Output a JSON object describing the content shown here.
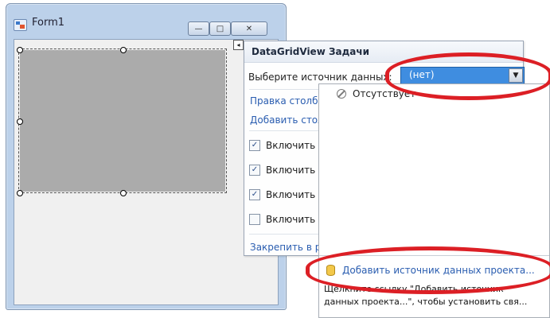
{
  "form": {
    "title": "Form1",
    "min_glyph": "—",
    "max_glyph": "□",
    "close_glyph": "✕"
  },
  "tasks_panel": {
    "title": "DataGridView Задачи",
    "smart_tag_glyph": "◂",
    "datasource_label": "Выберите источник данных:",
    "datasource_value": "(нет)",
    "dropdown_glyph": "▼",
    "links": [
      "Правка столбцов...",
      "Добавить столбец..."
    ],
    "options": [
      {
        "label": "Включить добавление",
        "checked": true
      },
      {
        "label": "Включить правку",
        "checked": true
      },
      {
        "label": "Включить удаление",
        "checked": true
      },
      {
        "label": "Включить переупорядочение столбцов",
        "checked": false
      }
    ],
    "dock_link": "Закрепить в родительском контейнере"
  },
  "dropdown": {
    "none_label": "Отсутствует",
    "add_label": "Добавить источник данных проекта...",
    "help_line1": "Щелкните ссылку \"Добавить источник",
    "help_line2": "данных проекта...\", чтобы установить свя..."
  },
  "colors": {
    "highlight": "#dc1f25",
    "selection": "#3f8de0",
    "link": "#2a5db0"
  }
}
